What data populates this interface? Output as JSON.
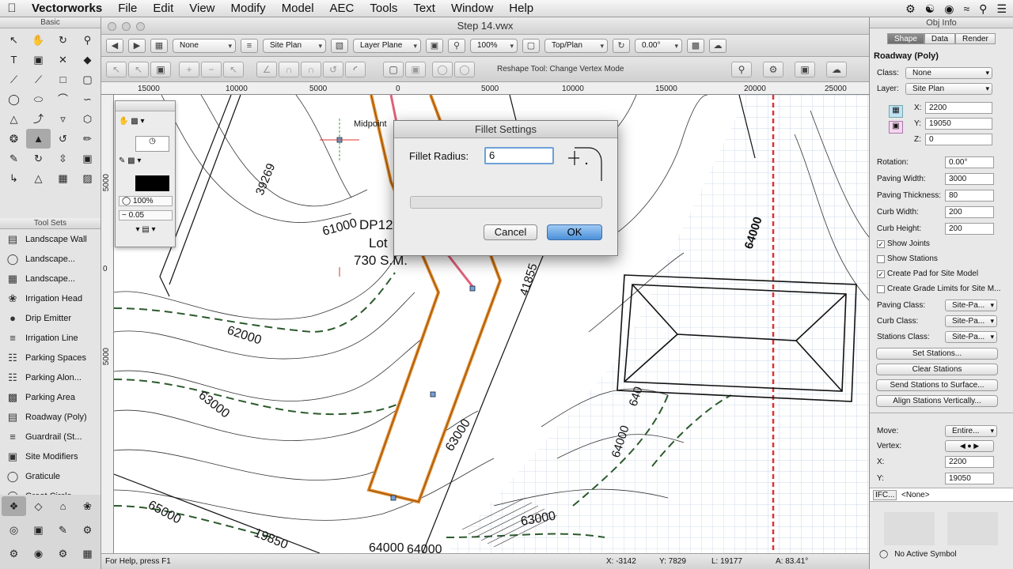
{
  "menubar": {
    "app": "Vectorworks",
    "items": [
      "File",
      "Edit",
      "View",
      "Modify",
      "Model",
      "AEC",
      "Tools",
      "Text",
      "Window",
      "Help"
    ]
  },
  "window": {
    "title": "Step 14.vwx"
  },
  "viewbar": {
    "class_popup": "None",
    "layer_popup": "Site Plan",
    "plane_popup": "Layer Plane",
    "zoom_popup": "100%",
    "view_popup": "Top/Plan",
    "angle_field": "0.00°"
  },
  "modebar": {
    "hint": "Reshape Tool: Change Vertex Mode"
  },
  "ruler": {
    "h_labels": [
      "15000",
      "10000",
      "5000",
      "0",
      "5000",
      "10000",
      "15000",
      "20000",
      "25000"
    ],
    "v_labels": [
      "5000",
      "0",
      "5000"
    ]
  },
  "left_palette": {
    "basic_title": "Basic",
    "toolsets_title": "Tool Sets",
    "tool_icons": [
      "arrow-icon",
      "pan-icon",
      "rotate-view-icon",
      "zoom-icon",
      "text-icon",
      "callout-icon",
      "x-icon",
      "fill-icon",
      "line-icon",
      "double-line-icon",
      "rectangle-icon",
      "rounded-rect-icon",
      "circle-icon",
      "oval-icon",
      "arc-icon",
      "freehand-icon",
      "polygon-icon",
      "double-polyline-icon",
      "triangle-icon",
      "hexagon-icon",
      "spiral-icon",
      "reshape-icon",
      "offset-icon",
      "eyedropper-icon",
      "attribute-icon",
      "fillet-icon",
      "mirror-icon",
      "move-icon",
      "connect-icon",
      "trim-icon",
      "split-icon",
      "clip-icon"
    ],
    "toolset_items": [
      "Landscape Wall",
      "Landscape...",
      "Landscape...",
      "Irrigation Head",
      "Drip Emitter",
      "Irrigation Line",
      "Parking Spaces",
      "Parking Alon...",
      "Parking Area",
      "Roadway (Poly)",
      "Guardrail (St...",
      "Site Modifiers",
      "Graticule",
      "Great Circle"
    ]
  },
  "attributes": {
    "zoom": "100%",
    "line_weight": "0.05"
  },
  "canvas": {
    "snap_label": "Midpoint",
    "lot_text": [
      "DP12",
      "Lot",
      "730 S.M."
    ],
    "contours": [
      "61000",
      "39269",
      "62000",
      "63000",
      "65000",
      "19850",
      "64000",
      "64000",
      "41855",
      "63000",
      "63000",
      "64000",
      "640",
      "64000"
    ]
  },
  "status": {
    "help": "For Help, press F1",
    "x": "X: -3142",
    "y": "Y: 7829",
    "l": "L: 19177",
    "a": "A: 83.41°"
  },
  "obj_info": {
    "palette_title": "Obj Info",
    "tabs": [
      "Shape",
      "Data",
      "Render"
    ],
    "object": "Roadway (Poly)",
    "class_label": "Class:",
    "class_value": "None",
    "layer_label": "Layer:",
    "layer_value": "Site Plan",
    "x_label": "X:",
    "x_value": "2200",
    "y_label": "Y:",
    "y_value": "19050",
    "z_label": "Z:",
    "z_value": "0",
    "rotation_label": "Rotation:",
    "rotation_value": "0.00°",
    "paving_width_label": "Paving Width:",
    "paving_width_value": "3000",
    "paving_thickness_label": "Paving Thickness:",
    "paving_thickness_value": "80",
    "curb_width_label": "Curb Width:",
    "curb_width_value": "200",
    "curb_height_label": "Curb Height:",
    "curb_height_value": "200",
    "show_joints": "Show Joints",
    "show_stations": "Show Stations",
    "create_pad": "Create Pad for Site Model",
    "create_grade": "Create Grade Limits for Site M...",
    "paving_class_label": "Paving Class:",
    "paving_class_value": "Site-Pa...",
    "curb_class_label": "Curb Class:",
    "curb_class_value": "Site-Pa...",
    "stations_class_label": "Stations Class:",
    "stations_class_value": "Site-Pa...",
    "btn_set_stations": "Set Stations...",
    "btn_clear_stations": "Clear Stations",
    "btn_send_stations": "Send Stations to Surface...",
    "btn_align_stations": "Align Stations Vertically...",
    "move_label": "Move:",
    "move_value": "Entire...",
    "vertex_label": "Vertex:",
    "vx_label": "X:",
    "vx_value": "2200",
    "vy_label": "Y:",
    "vy_value": "19050",
    "ifc_button": "IFC...",
    "ifc_value": "<None>",
    "no_symbol": "No Active Symbol"
  },
  "dialog": {
    "title": "Fillet Settings",
    "label": "Fillet Radius:",
    "value": "6",
    "cancel": "Cancel",
    "ok": "OK"
  }
}
